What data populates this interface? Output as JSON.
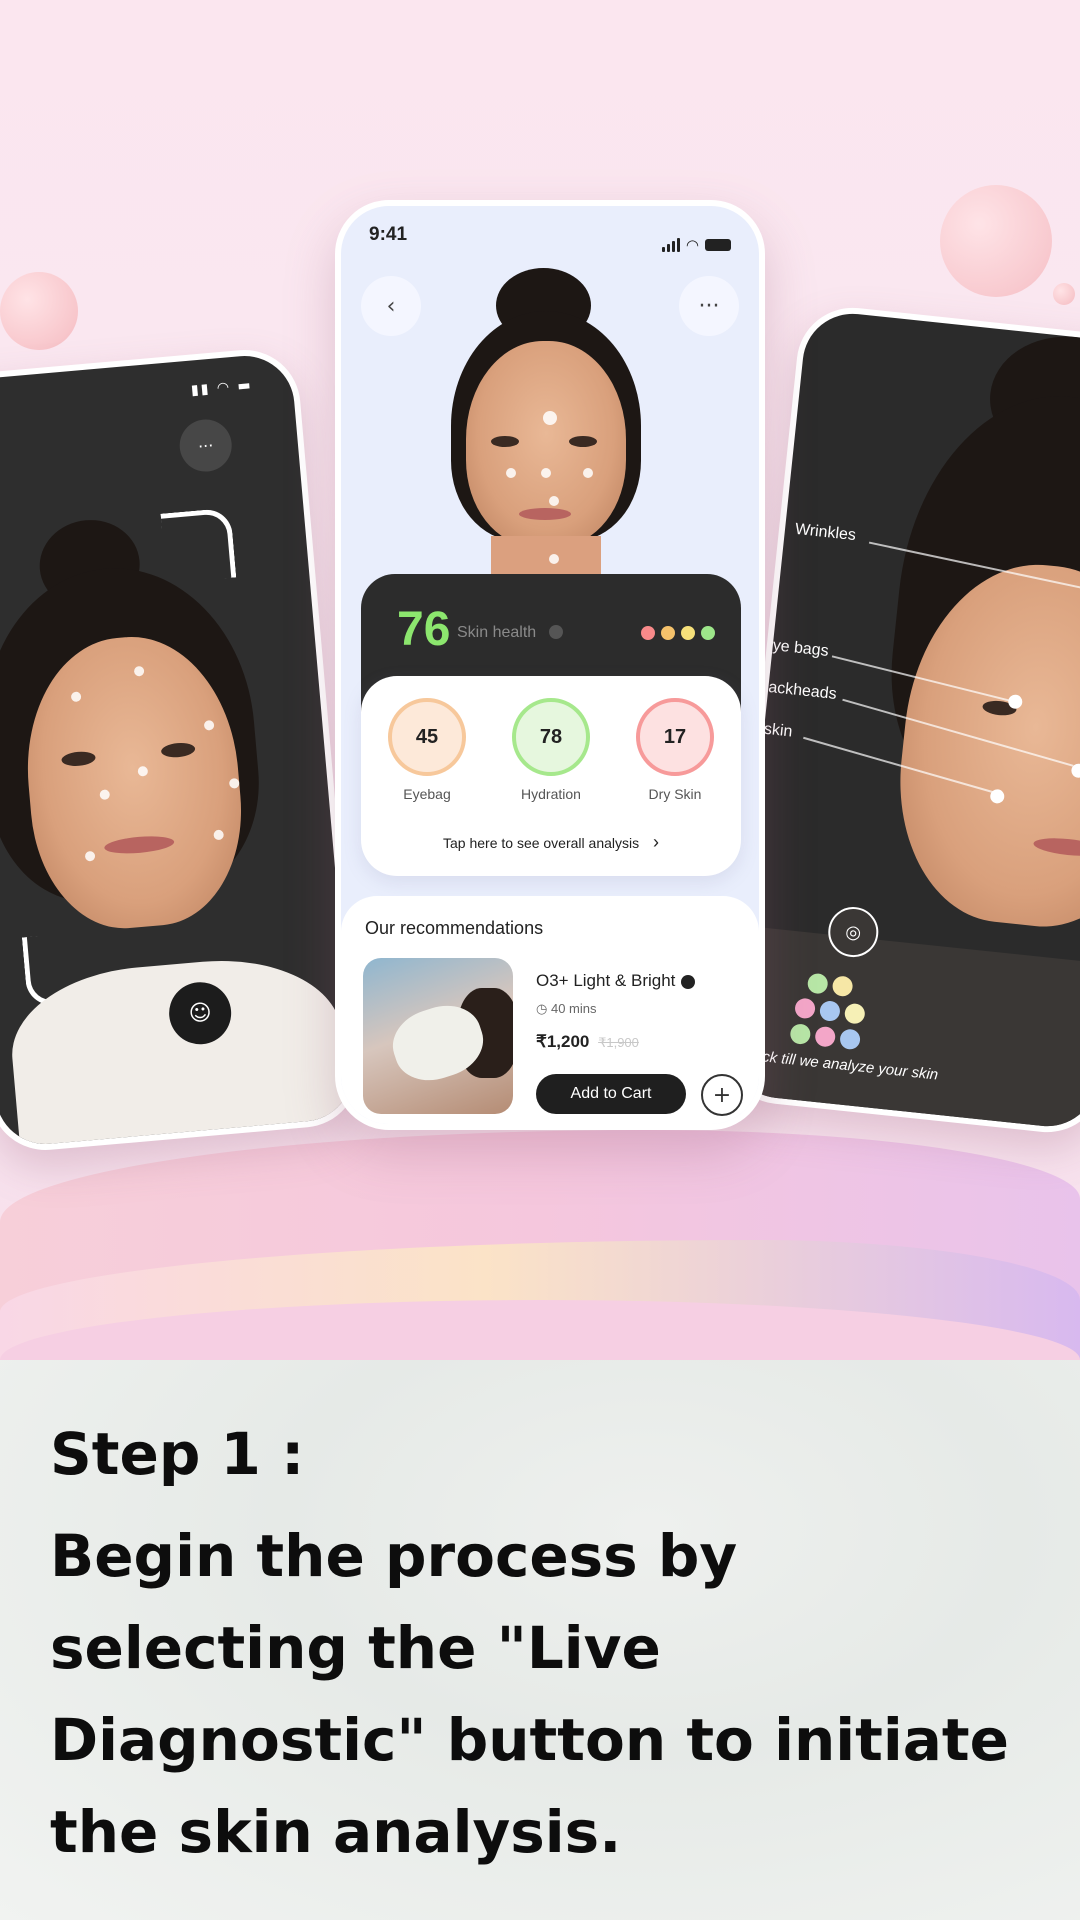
{
  "center_phone": {
    "status_time": "9:41",
    "back_glyph": "‹",
    "more_glyph": "···",
    "score": {
      "value": "76",
      "label": "Skin health",
      "dot_colors": [
        "#f88a8a",
        "#f5c26b",
        "#f6e07a",
        "#9de68a"
      ]
    },
    "metrics": [
      {
        "value": "45",
        "label": "Eyebag",
        "ring_color": "#f7c89b",
        "fill_color": "#fde9d9"
      },
      {
        "value": "78",
        "label": "Hydration",
        "ring_color": "#a6e88c",
        "fill_color": "#e6f7de"
      },
      {
        "value": "17",
        "label": "Dry Skin",
        "ring_color": "#f79a9a",
        "fill_color": "#fde1e1"
      }
    ],
    "analysis_link": "Tap here to see overall analysis",
    "analysis_chevron": "›",
    "recommendations": {
      "title": "Our recommendations",
      "item": {
        "name": "O3+ Light & Bright",
        "duration": "40 mins",
        "price": "₹1,200",
        "old_price": "₹1,900",
        "cart_label": "Add to Cart",
        "plus_glyph": "+"
      }
    }
  },
  "right_phone": {
    "labels": [
      "Wrinkles",
      "ye bags",
      "ackheads",
      "skin"
    ],
    "caption": "ld back till we analyze your skin",
    "palette": [
      "#b7e6a6",
      "#f6e7a6",
      "#f3a6c8",
      "#a8c7f0",
      "#f6f0b6",
      "#b7e6a6",
      "#f3a6c8",
      "#a8c7f0"
    ]
  },
  "left_phone": {
    "more_glyph": "···"
  },
  "caption": {
    "title": "Step 1 :",
    "body": "Begin the process by selecting the \"Live Diagnostic\" button to initiate the skin analysis."
  }
}
